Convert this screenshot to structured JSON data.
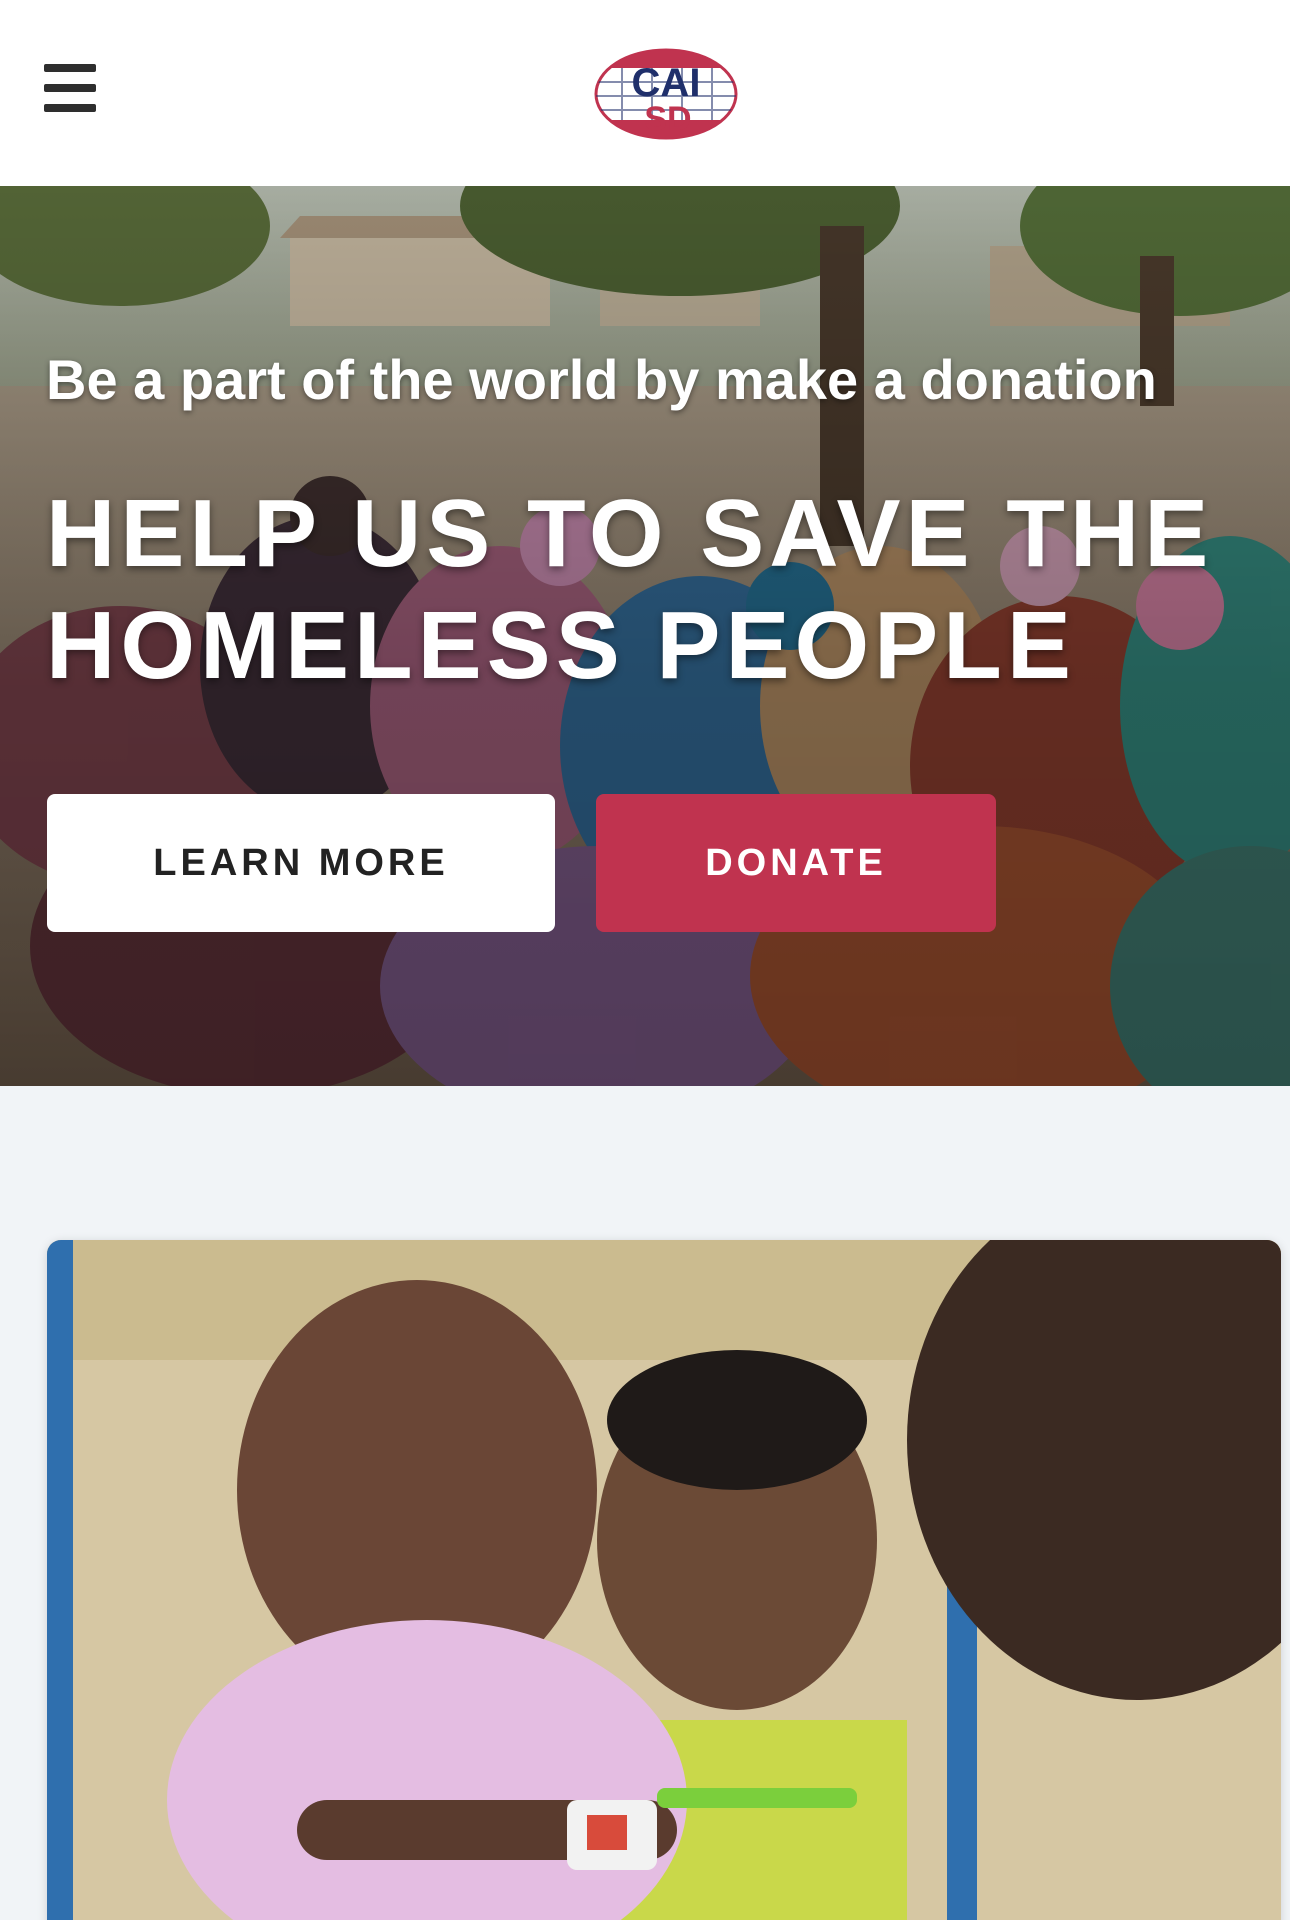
{
  "header": {
    "menu_icon": "hamburger-menu-icon",
    "logo": {
      "letters": "CAISD",
      "text_color": "#1f2f6b",
      "accent_color": "#c0334f"
    }
  },
  "hero": {
    "subtitle": "Be a part of the world by make a donation",
    "title_line1": "HELP US TO SAVE THE",
    "title_line2": "HOMELESS PEOPLE",
    "learn_more_label": "LEARN MORE",
    "donate_label": "DONATE",
    "donate_color": "#c0334f"
  },
  "section": {
    "background": "#f1f4f7",
    "photo_description_icon": "child-mid-upper-arm-measurement-photo"
  }
}
